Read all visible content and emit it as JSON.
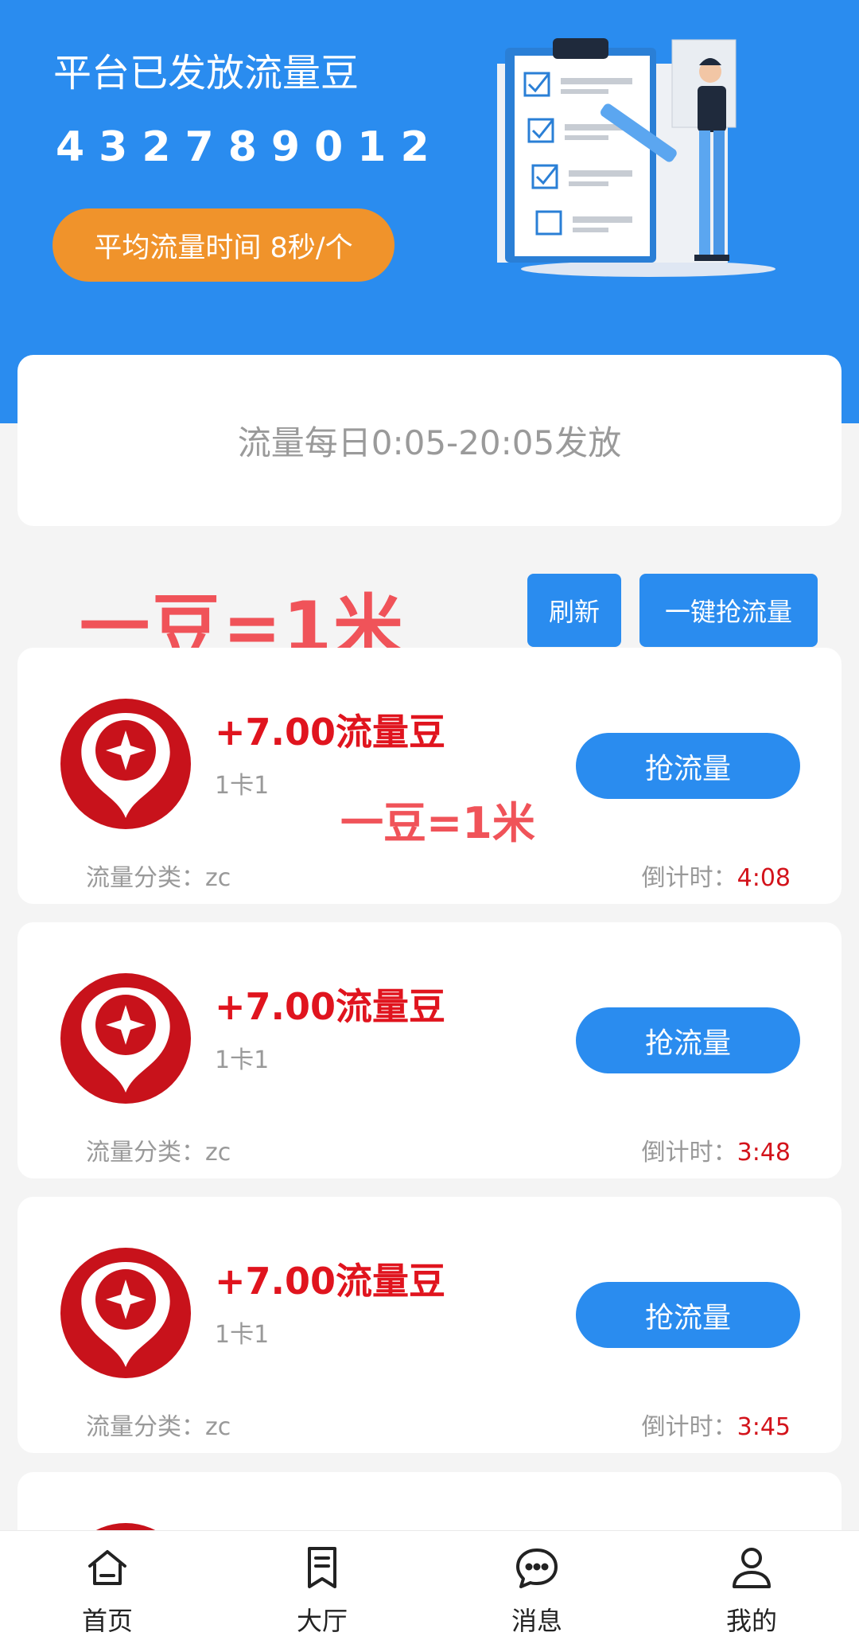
{
  "hero": {
    "title": "平台已发放流量豆",
    "count": "432789012",
    "avg_label": "平均流量时间 8秒/个"
  },
  "notice": {
    "text": "流量每日0:05-20:05发放"
  },
  "promo_text": "一豆=1米",
  "actions": {
    "refresh_label": "刷新",
    "grab_all_label": "一键抢流量"
  },
  "cards": [
    {
      "amount": "+7.00流量豆",
      "sub": "1卡1",
      "button": "抢流量",
      "category": "流量分类：zc",
      "countdown_label": "倒计时：",
      "countdown_time": "4:08",
      "promo": "一豆=1米"
    },
    {
      "amount": "+7.00流量豆",
      "sub": "1卡1",
      "button": "抢流量",
      "category": "流量分类：zc",
      "countdown_label": "倒计时：",
      "countdown_time": "3:48"
    },
    {
      "amount": "+7.00流量豆",
      "sub": "1卡1",
      "button": "抢流量",
      "category": "流量分类：zc",
      "countdown_label": "倒计时：",
      "countdown_time": "3:45"
    }
  ],
  "tabbar": [
    {
      "label": "首页",
      "icon": "home-icon"
    },
    {
      "label": "大厅",
      "icon": "bookmark-icon"
    },
    {
      "label": "消息",
      "icon": "chat-icon"
    },
    {
      "label": "我的",
      "icon": "user-icon"
    }
  ],
  "colors": {
    "primary": "#2a8cef",
    "accent_orange": "#f0932b",
    "amount_red": "#e0141e",
    "promo_red": "#f05359"
  }
}
